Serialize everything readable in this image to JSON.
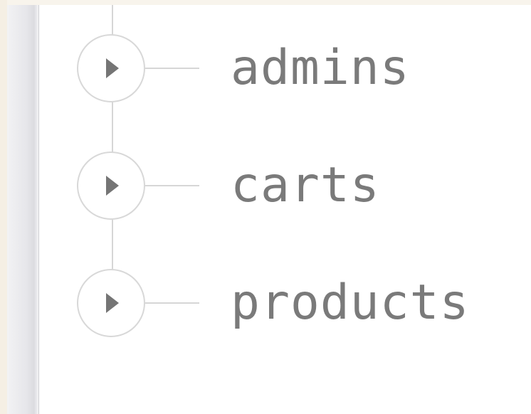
{
  "collections": [
    {
      "name": "admins",
      "icon": "chevron-right-icon"
    },
    {
      "name": "carts",
      "icon": "chevron-right-icon"
    },
    {
      "name": "products",
      "icon": "chevron-right-icon"
    }
  ],
  "colors": {
    "label": "#7a7a7a",
    "connector": "#d6d6d6",
    "node_border": "#d8d8d8",
    "chevron": "#757575"
  }
}
